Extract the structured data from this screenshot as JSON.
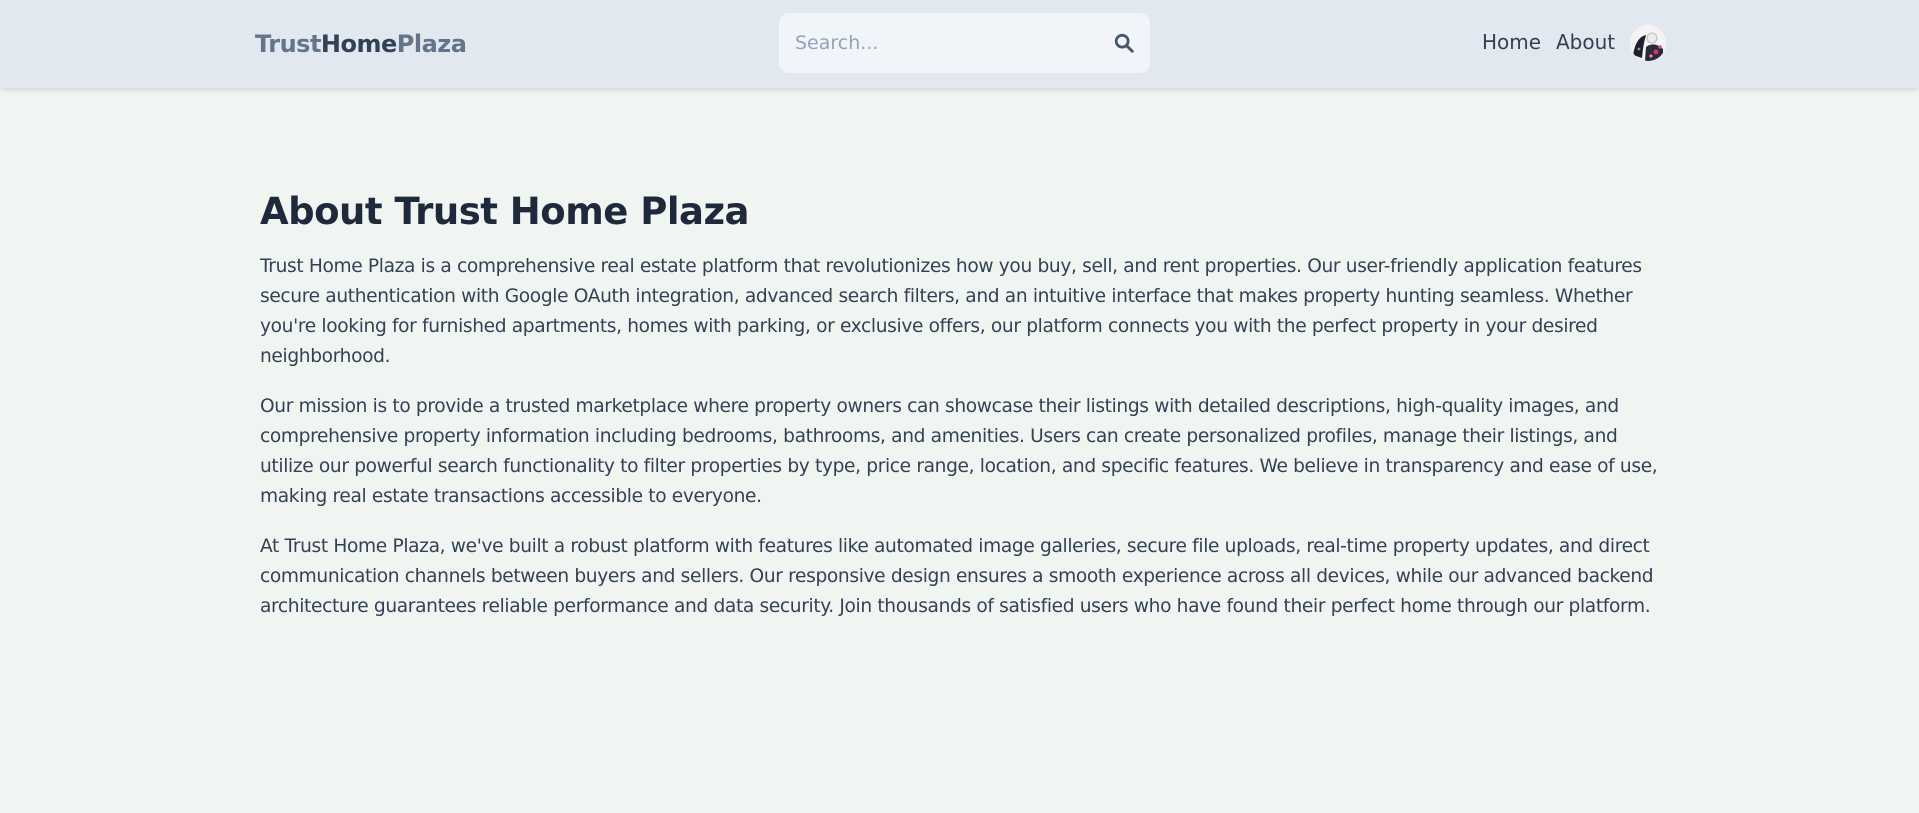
{
  "header": {
    "logo": {
      "part1": "Trust",
      "part2": "Home",
      "part3": "Plaza"
    },
    "search": {
      "placeholder": "Search...",
      "value": "",
      "icon": "search-icon"
    },
    "nav": {
      "home": "Home",
      "about": "About"
    },
    "avatar_icon": "avatar"
  },
  "main": {
    "title": "About Trust Home Plaza",
    "paragraphs": [
      "Trust Home Plaza is a comprehensive real estate platform that revolutionizes how you buy, sell, and rent properties. Our user-friendly application features secure authentication with Google OAuth integration, advanced search filters, and an intuitive interface that makes property hunting seamless. Whether you're looking for furnished apartments, homes with parking, or exclusive offers, our platform connects you with the perfect property in your desired neighborhood.",
      "Our mission is to provide a trusted marketplace where property owners can showcase their listings with detailed descriptions, high-quality images, and comprehensive property information including bedrooms, bathrooms, and amenities. Users can create personalized profiles, manage their listings, and utilize our powerful search functionality to filter properties by type, price range, location, and specific features. We believe in transparency and ease of use, making real estate transactions accessible to everyone.",
      "At Trust Home Plaza, we've built a robust platform with features like automated image galleries, secure file uploads, real-time property updates, and direct communication channels between buyers and sellers. Our responsive design ensures a smooth experience across all devices, while our advanced backend architecture guarantees reliable performance and data security. Join thousands of satisfied users who have found their perfect home through our platform."
    ]
  },
  "colors": {
    "header_bg": "#e2e8f0",
    "page_bg": "#f1f5f1",
    "logo_light": "#64748b",
    "logo_dark": "#334155",
    "heading": "#1e293b",
    "body_text": "#334155"
  }
}
